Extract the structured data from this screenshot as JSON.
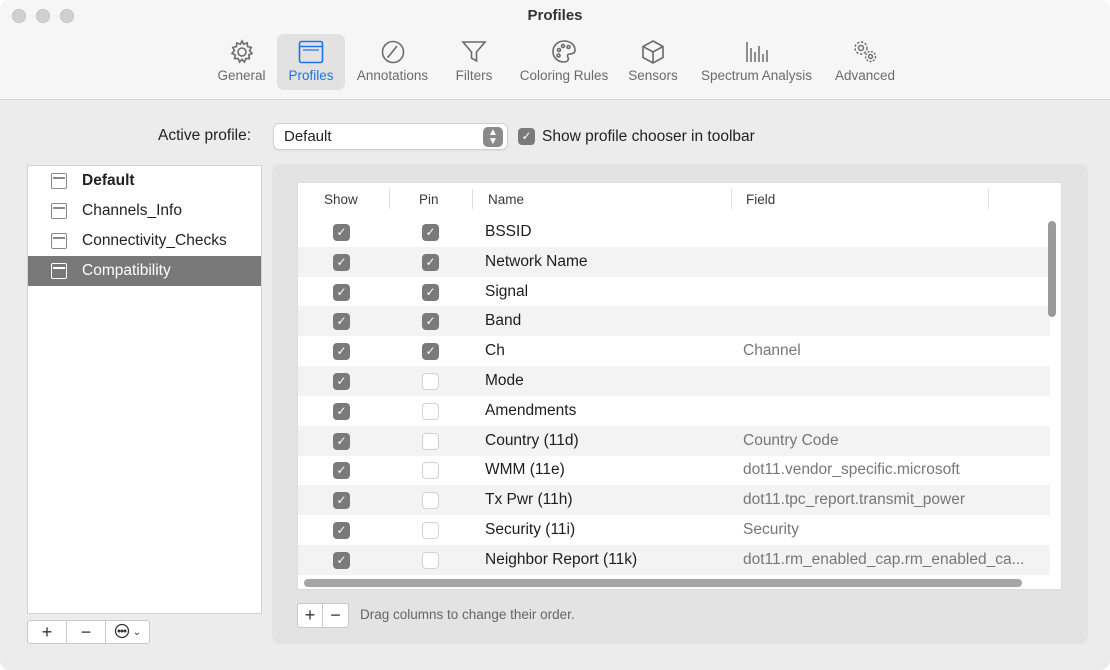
{
  "window": {
    "title": "Profiles"
  },
  "toolbar": {
    "items": [
      {
        "label": "General",
        "icon": "gear-icon"
      },
      {
        "label": "Profiles",
        "icon": "window-icon",
        "active": true
      },
      {
        "label": "Annotations",
        "icon": "pencil-circle-icon"
      },
      {
        "label": "Filters",
        "icon": "funnel-icon"
      },
      {
        "label": "Coloring Rules",
        "icon": "palette-icon"
      },
      {
        "label": "Sensors",
        "icon": "cube-icon"
      },
      {
        "label": "Spectrum Analysis",
        "icon": "spectrum-bars-icon"
      },
      {
        "label": "Advanced",
        "icon": "gears-icon"
      }
    ]
  },
  "active_profile": {
    "label": "Active profile:",
    "value": "Default",
    "show_chooser_label": "Show profile chooser in toolbar",
    "show_chooser_checked": true
  },
  "profiles": {
    "items": [
      {
        "label": "Default",
        "bold": true
      },
      {
        "label": "Channels_Info"
      },
      {
        "label": "Connectivity_Checks"
      },
      {
        "label": "Compatibility",
        "selected": true
      }
    ],
    "buttons": {
      "add": "+",
      "remove": "−"
    }
  },
  "table": {
    "headers": {
      "show": "Show",
      "pin": "Pin",
      "name": "Name",
      "field": "Field"
    },
    "rows": [
      {
        "show": true,
        "pin": true,
        "name": "BSSID",
        "field": ""
      },
      {
        "show": true,
        "pin": true,
        "name": "Network Name",
        "field": ""
      },
      {
        "show": true,
        "pin": true,
        "name": "Signal",
        "field": ""
      },
      {
        "show": true,
        "pin": true,
        "name": "Band",
        "field": ""
      },
      {
        "show": true,
        "pin": true,
        "name": "Ch",
        "field": "Channel"
      },
      {
        "show": true,
        "pin": false,
        "name": "Mode",
        "field": ""
      },
      {
        "show": true,
        "pin": false,
        "name": "Amendments",
        "field": ""
      },
      {
        "show": true,
        "pin": false,
        "name": "Country (11d)",
        "field": "Country Code"
      },
      {
        "show": true,
        "pin": false,
        "name": "WMM (11e)",
        "field": "dot11.vendor_specific.microsoft"
      },
      {
        "show": true,
        "pin": false,
        "name": "Tx Pwr (11h)",
        "field": "dot11.tpc_report.transmit_power"
      },
      {
        "show": true,
        "pin": false,
        "name": "Security (11i)",
        "field": "Security"
      },
      {
        "show": true,
        "pin": false,
        "name": "Neighbor Report (11k)",
        "field": "dot11.rm_enabled_cap.rm_enabled_ca..."
      }
    ],
    "buttons": {
      "add": "+",
      "remove": "−"
    },
    "hint": "Drag columns to change their order."
  },
  "colors": {
    "accent": "#1f73e8",
    "selection": "#787878",
    "checkbox": "#7a7a7a"
  }
}
